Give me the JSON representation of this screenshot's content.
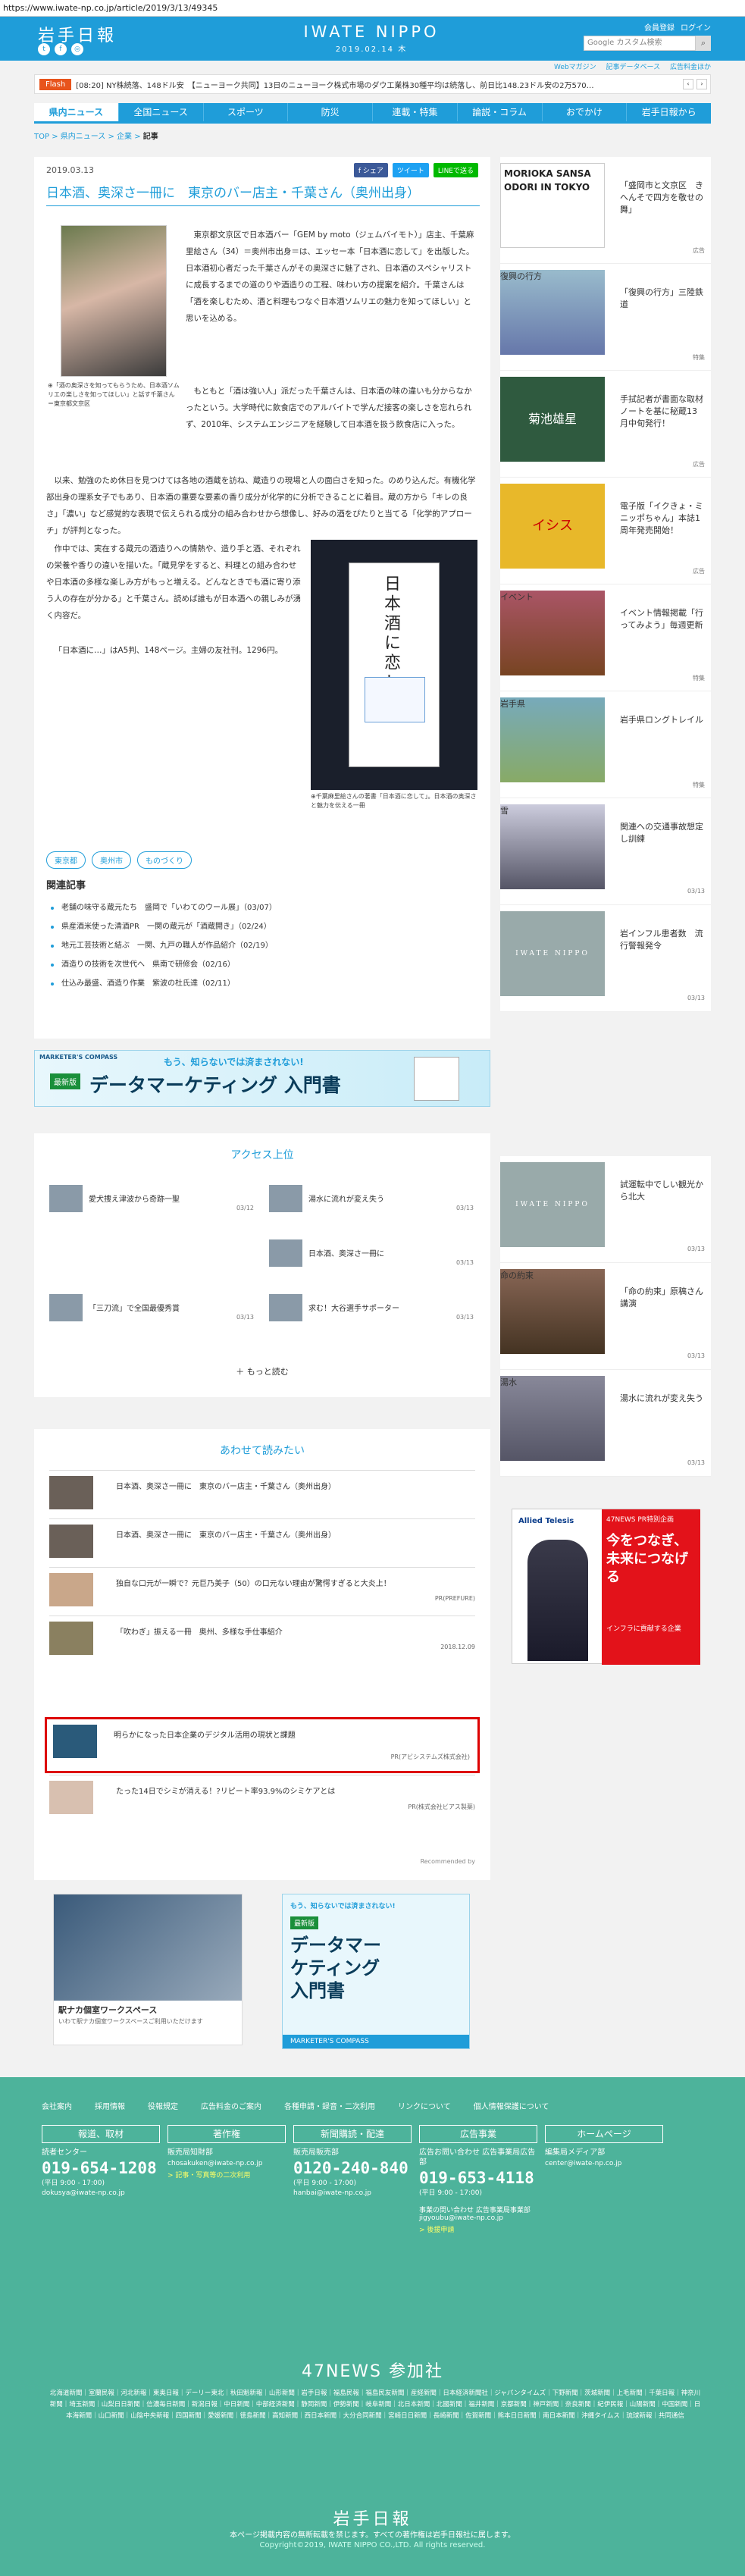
{
  "url": "https://www.iwate-np.co.jp/article/2019/3/13/49345",
  "header": {
    "logo": "岩手日報",
    "brand": "IWATE NIPPO",
    "brand_date": "2019.02.14 木",
    "member_register": "会員登録",
    "login": "ログイン",
    "search_placeholder": "Google カスタム検索"
  },
  "subnav": [
    "Webマガジン",
    "記事データベース",
    "広告料金ほか"
  ],
  "flash": {
    "tag": "Flash",
    "text": "[08:20] NY株続落、148ドル安　【ニューヨーク共同】13日のニューヨーク株式市場のダウ工業株30種平均は続落し、前日比148.23ドル安の2万570…"
  },
  "mainnav": [
    "県内ニュース",
    "全国ニュース",
    "スポーツ",
    "防災",
    "連載・特集",
    "論説・コラム",
    "おでかけ",
    "岩手日報から"
  ],
  "breadcrumb": {
    "top": "TOP",
    "c1": "県内ニュース",
    "c2": "企業",
    "current": "記事"
  },
  "article": {
    "date": "2019.03.13",
    "share": [
      "f シェア",
      "ツイート",
      "LINEで送る"
    ],
    "title": "日本酒、奥深さ一冊に　東京のバー店主・千葉さん（奥州出身）",
    "photo_caption": "「酒の奥深さを知ってもらうため、日本酒ソムリエの楽しさを知ってほしい」と話す千葉さん＝東京都文京区",
    "p1": "東京都文京区で日本酒バー「GEM by moto（ジェムバイモト）」店主、千葉麻里絵さん（34）＝奥州市出身＝は、エッセー本「日本酒に恋して」を出版した。日本酒初心者だった千葉さんがその奥深さに魅了され、日本酒のスペシャリストに成長するまでの道のりや酒造りの工程、味わい方の提案を紹介。千葉さんは「酒を楽しむため、酒と料理もつなぐ日本酒ソムリエの魅力を知ってほしい」と思いを込める。",
    "p2": "もともと「酒は強い人」派だった千葉さんは、日本酒の味の違いも分からなかったという。大学時代に飲食店でのアルバイトで学んだ接客の楽しさを忘れられず、2010年、システムエンジニアを経験して日本酒を扱う飲食店に入った。",
    "p3": "以来、勉強のため休日を見つけては各地の酒蔵を訪ね、蔵造りの現場と人の面白さを知った。のめり込んだ。有機化学部出身の理系女子でもあり、日本酒の重要な要素の香り成分が化学的に分析できることに着目。蔵の方から「キレの良さ」「濃い」など感覚的な表現で伝えられる成分の組み合わせから想像し、好みの酒をぴたりと当てる「化学的アプローチ」が評判となった。",
    "p4": "作中では、実在する蔵元の酒造りへの情熱や、造り手と酒、それぞれの栄養や香りの違いを描いた。「蔵見学をすると、料理との組み合わせや日本酒の多様な楽しみ方がもっと増える。どんなときでも酒に寄り添う人の存在が分かる」と千葉さん。読めば誰もが日本酒への親しみが湧く内容だ。",
    "p5": "「日本酒に…」はA5判、148ページ。主婦の友社刊。1296円。",
    "book_title": "日本酒に恋して",
    "book_caption": "千葉麻里絵さんの著書「日本酒に恋して」。日本酒の奥深さと魅力を伝える一冊",
    "tags": [
      "東京都",
      "奥州市",
      "ものづくり"
    ],
    "related_heading": "関連記事",
    "related": [
      "老舗の味守る蔵元たち　盛岡で「いわてのウール展」（03/07）",
      "県産酒米使った清酒PR　一関の蔵元が「酒蔵開き」（02/24）",
      "地元工芸技術と結ぶ　一関、九戸の職人が作品紹介（02/19）",
      "酒造りの技術を次世代へ　県南で研修会（02/16）",
      "仕込み最盛、酒造り作業　紫波の杜氏達（02/11）"
    ]
  },
  "banner": {
    "brand": "MARKETER'S COMPASS",
    "top": "もう、知らないでは済まされない!",
    "badge": "最新版",
    "main": "データマーケティング 入門書"
  },
  "access": {
    "heading": "アクセス上位",
    "items": [
      {
        "title": "愛犬捜え津波から奇跡一聖",
        "date": "03/12"
      },
      {
        "title": "湯水に流れが変え失う",
        "date": "03/13"
      },
      {
        "title": "日本酒、奥深さ一冊に",
        "date": "03/13"
      },
      {
        "title": "「三刀流」で全国最優秀賞",
        "date": "03/13"
      },
      {
        "title": "求む！大谷選手サポーター",
        "date": "03/13"
      }
    ],
    "more": "もっと読む"
  },
  "together": {
    "heading": "あわせて読みたい",
    "items": [
      {
        "title": "日本酒、奥深さ一冊に　東京のバー店主・千葉さん（奥州出身）",
        "pr": ""
      },
      {
        "title": "日本酒、奥深さ一冊に　東京のバー店主・千葉さん（奥州出身）",
        "pr": ""
      },
      {
        "title": "独自な口元が一瞬で？元巨乃美子（50）の口元ない理由が驚愕すぎると大炎上！",
        "pr": "PR(PREFURE)"
      },
      {
        "title": "「吹わぎ」振える一冊　奥州、多様な手仕事紹介",
        "pr": "2018.12.09"
      },
      {
        "title": "明らかになった日本企業のデジタル活用の現状と課題",
        "pr": "PR(アビシステムズ株式会社)"
      },
      {
        "title": "たった14日でシミが消える！?リピート率93.9%のシミケアとは",
        "pr": "PR(株式会社ビアス製薬)"
      }
    ],
    "recommended": "Recommended by"
  },
  "ads_bottom": {
    "left_title": "駅ナカ個室ワークスペース",
    "left_sub": "いわて駅ナカ個室ワークスペースご利用いただけます",
    "right_top": "もう、知らないでは済まされない!",
    "right_badge": "最新版",
    "right_main": "データマーケティング入門書",
    "right_brand": "MARKETER'S COMPASS"
  },
  "sidebar": {
    "top": [
      {
        "title": "MORIOKA SANSA ODORI IN TOKYO",
        "text": "「盛岡市と文京区　きへんそで四方を敬せの舞」",
        "cat": "広告"
      },
      {
        "title": "復興の行方",
        "text": "「復興の行方」三陸鉄道",
        "cat": "特集"
      },
      {
        "title": "菊池雄星",
        "text": "手拭記者が書面な取材ノートを基に秘蔵13月中旬発行！",
        "cat": "広告"
      },
      {
        "title": "イシス",
        "text": "電子版「イクきょ・ミニッポちゃん」本誌1周年発売開始！",
        "cat": "広告"
      },
      {
        "title": "イベント",
        "text": "イベント情報掲載「行ってみよう」毎週更新",
        "cat": "特集"
      },
      {
        "title": "岩手県",
        "text": "岩手県ロングトレイル",
        "cat": "特集"
      },
      {
        "title": "雪",
        "text": "関連への交通事故想定し訓練",
        "cat": "03/13"
      },
      {
        "title": "IWATE NIPPO",
        "text": "岩インフル患者数　流行警報発令",
        "cat": "03/13"
      }
    ],
    "bottom": [
      {
        "title": "IWATE NIPPO",
        "text": "試運転中でしい観光から北大",
        "cat": "03/13"
      },
      {
        "title": "命の約束",
        "text": "「命の約束」原稿さん講演",
        "cat": "03/13"
      },
      {
        "title": "湯水",
        "text": "湯水に流れが変え失う",
        "cat": "03/13"
      }
    ],
    "ad": {
      "brand": "Allied Telesis",
      "text": "今をつなぎ、未来につなげる",
      "sub": "インフラに貢献する企業",
      "head": "47NEWS PR特別企画"
    }
  },
  "footer": {
    "links": [
      "会社案内",
      "採用情報",
      "役報規定",
      "広告料金のご案内",
      "各種申請・録音・二次利用",
      "リンクについて",
      "個人情報保護について"
    ],
    "cols": [
      {
        "head": "報道、取材",
        "label": "読者センター",
        "phone": "019-654-1208",
        "hours": "(平日 9:00 - 17:00)",
        "mail": "dokusya@iwate-np.co.jp",
        "small": ""
      },
      {
        "head": "著作権",
        "label": "販売局知財部",
        "phone": "",
        "hours": "",
        "mail": "chosakuken@iwate-np.co.jp",
        "small": "> 記事・写真等の二次利用"
      },
      {
        "head": "新聞購読・配達",
        "label": "販売局販売部",
        "phone": "0120-240-840",
        "hours": "(平日 9:00 - 17:00)",
        "mail": "hanbai@iwate-np.co.jp",
        "small": ""
      },
      {
        "head": "広告事業",
        "label": "広告お問い合わせ 広告事業局広告部",
        "phone": "019-653-4118",
        "hours": "(平日 9:00 - 17:00)",
        "mail": "事業の問い合わせ 広告事業局事業部 jigyoubu@iwate-np.co.jp",
        "small": "> 後援申請"
      },
      {
        "head": "ホームページ",
        "label": "編集局メディア部",
        "phone": "",
        "hours": "",
        "mail": "center@iwate-np.co.jp",
        "small": ""
      }
    ],
    "n47": "47NEWS 参加社",
    "papers": "北海道新聞｜室蘭民報｜河北新報｜東奥日報｜デーリー東北｜秋田魁新報｜山形新聞｜岩手日報｜福島民報｜福島民友新聞｜産経新聞｜日本経済新聞社｜ジャパンタイムズ｜下野新聞｜茨城新聞｜上毛新聞｜千葉日報｜神奈川新聞｜埼玉新聞｜山梨日日新聞｜信濃毎日新聞｜新潟日報｜中日新聞｜中部経済新聞｜静岡新聞｜伊勢新聞｜岐阜新聞｜北日本新聞｜北國新聞｜福井新聞｜京都新聞｜神戸新聞｜奈良新聞｜紀伊民報｜山陽新聞｜中国新聞｜日本海新聞｜山口新聞｜山陰中央新報｜四国新聞｜愛媛新聞｜徳島新聞｜高知新聞｜西日本新聞｜大分合同新聞｜宮崎日日新聞｜長崎新聞｜佐賀新聞｜熊本日日新聞｜南日本新聞｜沖縄タイムス｜琉球新報｜共同通信",
    "logo": "岩手日報",
    "note": "本ページ掲載内容の無断転載を禁じます。すべての著作権は岩手日報社に属します。",
    "copy": "Copyright©2019, IWATE NIPPO CO.,LTD. All rights reserved."
  }
}
